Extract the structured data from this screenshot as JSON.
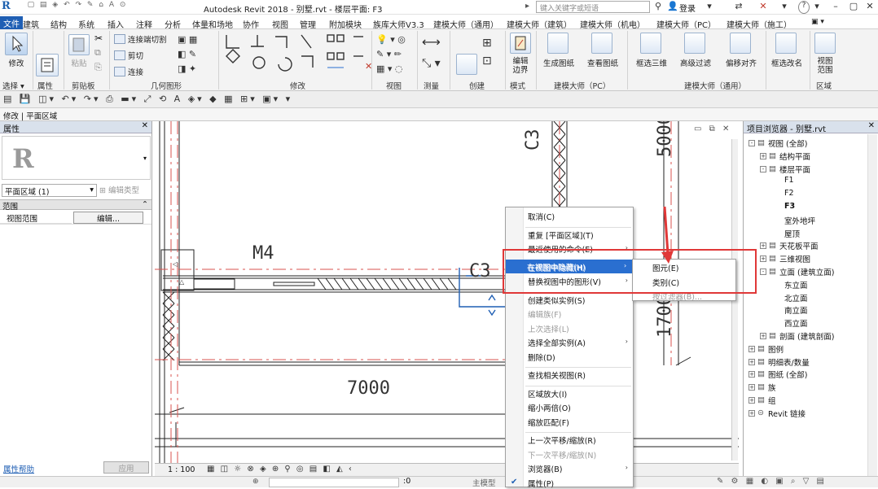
{
  "titlebar": {
    "app": "Autodesk Revit 2018 -",
    "file": "别墅.rvt - 楼层平面: F3",
    "search_placeholder": "键入关键字或短语",
    "login": "登录",
    "help": "?"
  },
  "tabs": [
    "文件",
    "建筑",
    "结构",
    "系统",
    "插入",
    "注释",
    "分析",
    "体量和场地",
    "协作",
    "视图",
    "管理",
    "附加模块",
    "族库大师V3.3",
    "建模大师（通用）",
    "建模大师（建筑）",
    "建模大师（机电）",
    "建模大师（PC）",
    "建模大师（施工）"
  ],
  "ribbon": {
    "modify": "修改",
    "select": "选择 ▾",
    "props": "属性",
    "paste": "粘贴",
    "clipboard": "剪贴板",
    "connect_cut": "连接端切割",
    "cut": "剪切",
    "join": "连接",
    "geometry": "几何图形",
    "modify_grp": "修改",
    "view_grp": "视图",
    "measure_grp": "测量",
    "create_grp": "创建",
    "edit_boundary": "编辑\n边界",
    "mode_grp": "模式",
    "gen_drawing": "生成图纸",
    "view_drawing": "查看图纸",
    "pc_grp": "建模大师（PC）",
    "box_3d": "框选三维",
    "adv_filter": "高级过滤",
    "offset_align": "偏移对齐",
    "general_grp": "建模大师（通用）",
    "box_rename": "框选改名",
    "view_range": "视图\n范围",
    "region_grp": "区域"
  },
  "option_bar": "修改 | 平面区域",
  "properties": {
    "header": "属性",
    "type": "平面区域 (1)",
    "edit_type": "编辑类型",
    "section": "范围",
    "row_label": "视图范围",
    "row_btn": "编辑...",
    "help": "属性帮助",
    "apply": "应用"
  },
  "canvas": {
    "dim_top": "5000",
    "dim_side": "1700",
    "dim_bottom": "7000",
    "tag_c3a": "C3",
    "tag_c3b": "C3",
    "tag_m4": "M4"
  },
  "viewbar": {
    "scale": "1 : 100"
  },
  "browser": {
    "header": "项目浏览器 - 别墅.rvt",
    "items": [
      {
        "t": "视图 (全部)",
        "lvl": 0,
        "tog": "-"
      },
      {
        "t": "结构平面",
        "lvl": 1,
        "tog": "+"
      },
      {
        "t": "楼层平面",
        "lvl": 1,
        "tog": "-"
      },
      {
        "t": "F1",
        "lvl": 2
      },
      {
        "t": "F2",
        "lvl": 2
      },
      {
        "t": "F3",
        "lvl": 2,
        "bold": true
      },
      {
        "t": "室外地坪",
        "lvl": 2
      },
      {
        "t": "屋顶",
        "lvl": 2
      },
      {
        "t": "天花板平面",
        "lvl": 1,
        "tog": "+"
      },
      {
        "t": "三维视图",
        "lvl": 1,
        "tog": "+"
      },
      {
        "t": "立面 (建筑立面)",
        "lvl": 1,
        "tog": "-"
      },
      {
        "t": "东立面",
        "lvl": 2
      },
      {
        "t": "北立面",
        "lvl": 2
      },
      {
        "t": "南立面",
        "lvl": 2
      },
      {
        "t": "西立面",
        "lvl": 2
      },
      {
        "t": "剖面 (建筑剖面)",
        "lvl": 1,
        "tog": "+"
      },
      {
        "t": "图例",
        "lvl": 0,
        "tog": "+"
      },
      {
        "t": "明细表/数量",
        "lvl": 0,
        "tog": "+"
      },
      {
        "t": "图纸 (全部)",
        "lvl": 0,
        "tog": "+"
      },
      {
        "t": "族",
        "lvl": 0,
        "tog": "+"
      },
      {
        "t": "组",
        "lvl": 0,
        "tog": "+"
      },
      {
        "t": "Revit 链接",
        "lvl": 0,
        "tog": "+"
      }
    ]
  },
  "context_menu": {
    "items": [
      {
        "t": "取消(C)"
      },
      {
        "sep": true
      },
      {
        "t": "重复 [平面区域](T)"
      },
      {
        "t": "最近使用的命令(E)",
        "arrow": true
      },
      {
        "sep": true
      },
      {
        "t": "在视图中隐藏(H)",
        "arrow": true,
        "hl": true
      },
      {
        "t": "替换视图中的图形(V)",
        "arrow": true
      },
      {
        "sep": true
      },
      {
        "t": "创建类似实例(S)"
      },
      {
        "t": "编辑族(F)",
        "dis": true
      },
      {
        "t": "上次选择(L)",
        "dis": true
      },
      {
        "t": "选择全部实例(A)",
        "arrow": true
      },
      {
        "t": "删除(D)"
      },
      {
        "sep": true
      },
      {
        "t": "查找相关视图(R)"
      },
      {
        "sep": true
      },
      {
        "t": "区域放大(I)"
      },
      {
        "t": "缩小两倍(O)"
      },
      {
        "t": "缩放匹配(F)"
      },
      {
        "sep": true
      },
      {
        "t": "上一次平移/缩放(R)"
      },
      {
        "t": "下一次平移/缩放(N)",
        "dis": true
      },
      {
        "t": "浏览器(B)",
        "arrow": true
      },
      {
        "t": "属性(P)",
        "check": true
      }
    ]
  },
  "submenu": [
    "图元(E)",
    "类别(C)",
    "按过滤器(B)..."
  ],
  "status": {
    "model": "主模型",
    "zero": ":0"
  },
  "colors": {
    "accent": "#1f5fb4",
    "highlight": "#2a6fd0",
    "annotation_red": "#e03838"
  }
}
